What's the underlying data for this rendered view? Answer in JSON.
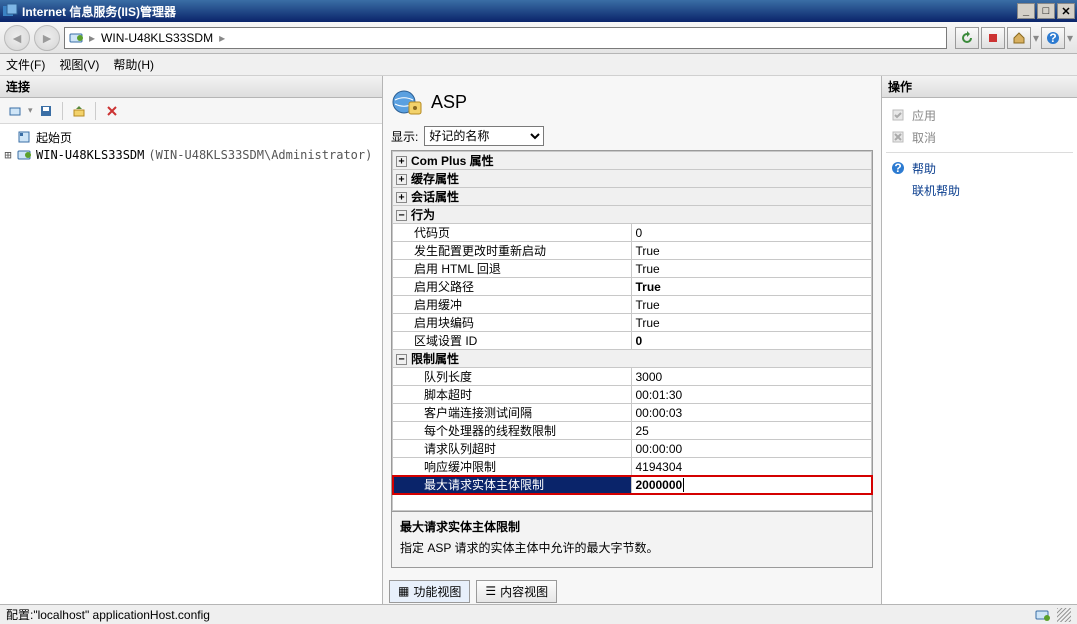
{
  "window": {
    "title": "Internet 信息服务(IIS)管理器"
  },
  "breadcrumb": {
    "host": "WIN-U48KLS33SDM"
  },
  "menu": {
    "file": "文件(F)",
    "view": "视图(V)",
    "help": "帮助(H)"
  },
  "left": {
    "header": "连接",
    "tree": {
      "start": "起始页",
      "host": "WIN-U48KLS33SDM",
      "host_paren": "(WIN-U48KLS33SDM\\Administrator)"
    }
  },
  "center": {
    "title": "ASP",
    "display_label": "显示:",
    "display_value": "好记的名称",
    "grid": {
      "cat_comPlus": "Com Plus 属性",
      "cat_cache": "缓存属性",
      "cat_session": "会话属性",
      "cat_behavior": "行为",
      "codePage_k": "代码页",
      "codePage_v": "0",
      "restart_k": "发生配置更改时重新启动",
      "restart_v": "True",
      "htmlFallback_k": "启用 HTML 回退",
      "htmlFallback_v": "True",
      "parentPaths_k": "启用父路径",
      "parentPaths_v": "True",
      "buffering_k": "启用缓冲",
      "buffering_v": "True",
      "chunked_k": "启用块编码",
      "chunked_v": "True",
      "localeId_k": "区域设置 ID",
      "localeId_v": "0",
      "cat_limits": "限制属性",
      "queueLen_k": "队列长度",
      "queueLen_v": "3000",
      "scriptTO_k": "脚本超时",
      "scriptTO_v": "00:01:30",
      "clientConn_k": "客户端连接测试间隔",
      "clientConn_v": "00:00:03",
      "threadsPerProc_k": "每个处理器的线程数限制",
      "threadsPerProc_v": "25",
      "reqQueueTO_k": "请求队列超时",
      "reqQueueTO_v": "00:00:00",
      "respBuf_k": "响应缓冲限制",
      "respBuf_v": "4194304",
      "maxReqEntity_k": "最大请求实体主体限制",
      "maxReqEntity_v": "2000000"
    },
    "desc": {
      "title": "最大请求实体主体限制",
      "body": "指定 ASP 请求的实体主体中允许的最大字节数。"
    },
    "tabs": {
      "features": "功能视图",
      "content": "内容视图"
    }
  },
  "right": {
    "header": "操作",
    "apply": "应用",
    "cancel": "取消",
    "help": "帮助",
    "onlineHelp": "联机帮助"
  },
  "status": {
    "text": "配置:\"localhost\" applicationHost.config"
  }
}
